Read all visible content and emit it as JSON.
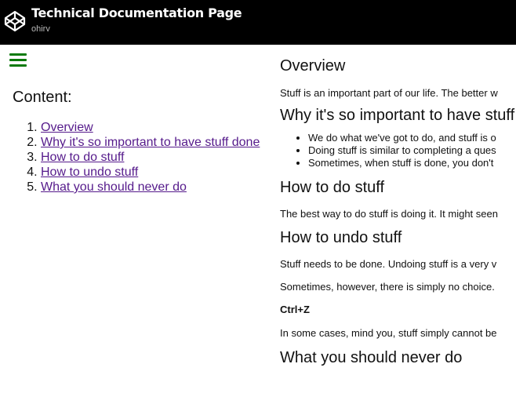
{
  "header": {
    "title": "Technical Documentation Page",
    "author": "ohirv",
    "logo_icon": "codepen-logo-icon",
    "background": "#000000"
  },
  "menu": {
    "icon": "hamburger-menu-icon",
    "color": "#0b7a0b"
  },
  "nav": {
    "title": "Content:",
    "items": [
      {
        "label": "Overview"
      },
      {
        "label": "Why it's so important to have stuff done"
      },
      {
        "label": "How to do stuff"
      },
      {
        "label": "How to undo stuff"
      },
      {
        "label": "What you should never do"
      }
    ],
    "link_color": "#551a8b"
  },
  "main": {
    "overview": {
      "title": "Overview",
      "text": "Stuff is an important part of our life. The better w"
    },
    "why": {
      "title": "Why it's so important to have stuff",
      "bullets": [
        "We do what we've got to do, and stuff is o",
        "Doing stuff is similar to completing a ques",
        "Sometimes, when stuff is done, you don't"
      ]
    },
    "how_to": {
      "title": "How to do stuff",
      "text": "The best way to do stuff is doing it. It might seen"
    },
    "undo": {
      "title": "How to undo stuff",
      "text1": "Stuff needs to be done. Undoing stuff is a very v",
      "text2": "Sometimes, however, there is simply no choice.",
      "shortcut": "Ctrl+Z",
      "text3": "In some cases, mind you, stuff simply cannot be"
    },
    "never": {
      "title": "What you should never do"
    }
  }
}
